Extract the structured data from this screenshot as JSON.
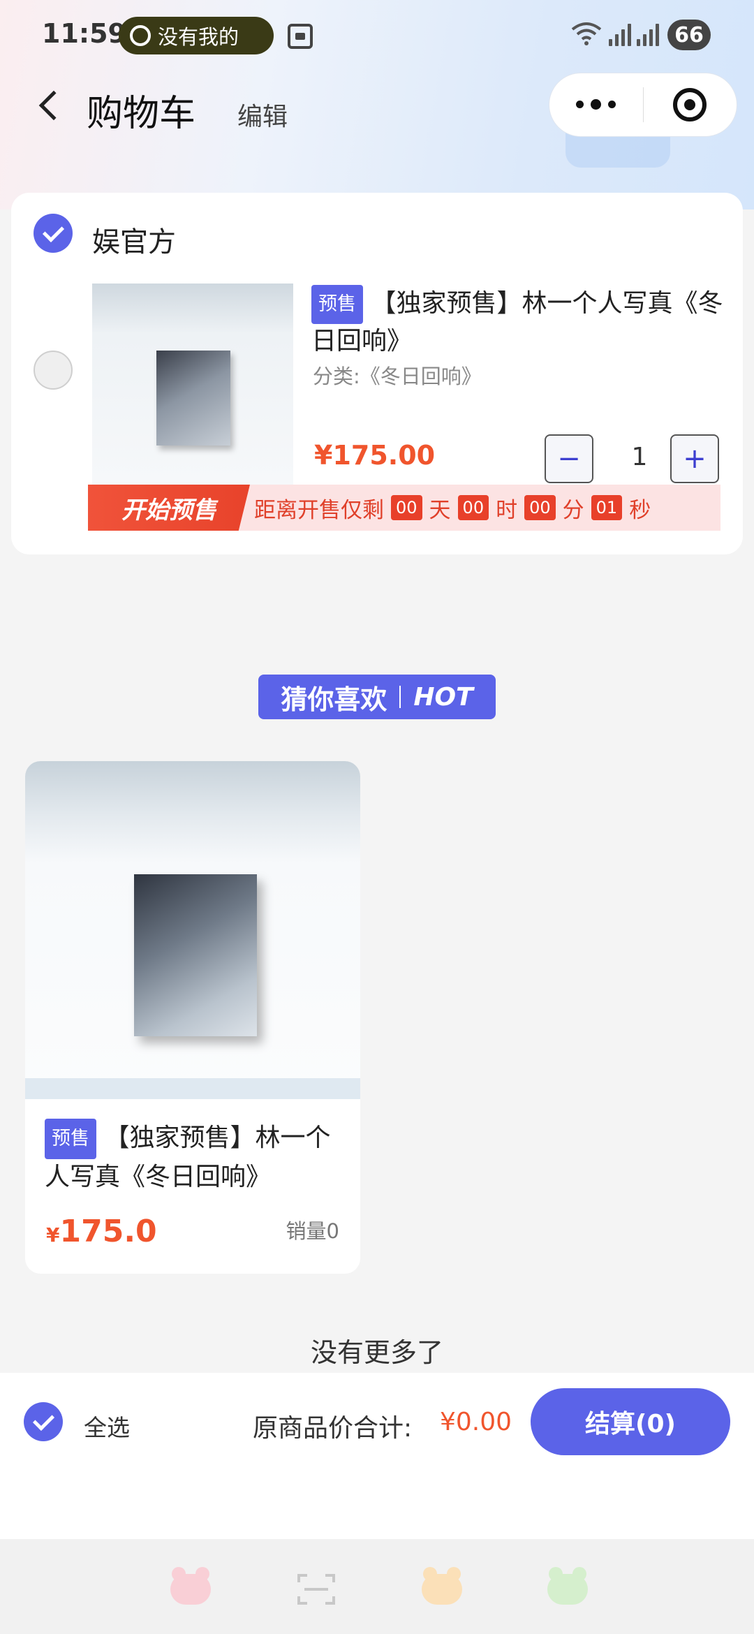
{
  "status_bar": {
    "time": "11:59",
    "notification_pill": "没有我的",
    "battery": "66"
  },
  "nav": {
    "title": "购物车",
    "edit_label": "编辑"
  },
  "cart": {
    "shop_name": "娱官方",
    "item": {
      "tag": "预售",
      "title": "【独家预售】林一个人写真《冬日回响》",
      "spec": "分类:《冬日回响》",
      "price": "¥175.00",
      "quantity": "1",
      "minus": "−",
      "plus": "+"
    },
    "presale": {
      "badge": "开始预售",
      "prefix": "距离开售仅剩",
      "days": "00",
      "days_unit": "天",
      "hours": "00",
      "hours_unit": "时",
      "minutes": "00",
      "minutes_unit": "分",
      "seconds": "01",
      "seconds_unit": "秒"
    }
  },
  "recommend": {
    "heading": "猜你喜欢",
    "hot": "HOT",
    "products": [
      {
        "tag": "预售",
        "title": "【独家预售】林一个人写真《冬日回响》",
        "currency": "¥",
        "price": "175.0",
        "sales": "销量0"
      }
    ],
    "no_more": "没有更多了"
  },
  "bottom_bar": {
    "select_all": "全选",
    "total_label": "原商品价合计:",
    "total_value": "¥0.00",
    "checkout": "结算(0)"
  },
  "tabbar": {
    "icons": [
      "frog-pink-icon",
      "scan-icon",
      "frog-yellow-icon",
      "frog-green-icon"
    ]
  },
  "colors": {
    "accent": "#5b63e8",
    "price": "#f0552d",
    "presale_red": "#e8402a"
  }
}
